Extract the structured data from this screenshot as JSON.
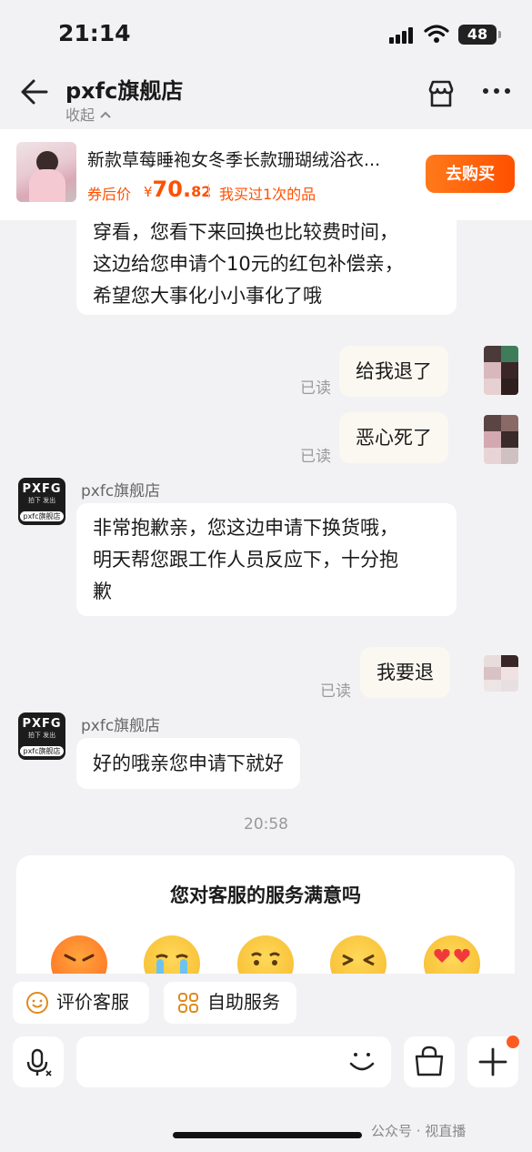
{
  "status_bar": {
    "time": "21:14",
    "battery": "48"
  },
  "header": {
    "shop_name": "pxfc旗舰店",
    "collapse_label": "收起"
  },
  "product": {
    "name": "新款草莓睡袍女冬季长款珊瑚绒浴衣...",
    "price_label": "券后价",
    "currency": "¥",
    "price_integer": "70.",
    "price_decimal": "82",
    "bought_note": "我买过1次的品",
    "buy_button": "去购买"
  },
  "messages": [
    {
      "from": "shop",
      "lines": [
        "穿看，您看下来回换也比较费时间，",
        "这边给您申请个10元的红包补偿亲，",
        "希望您大事化小小事化了哦"
      ]
    },
    {
      "from": "user",
      "text": "给我退了",
      "status": "已读"
    },
    {
      "from": "user",
      "text": "恶心死了",
      "status": "已读"
    },
    {
      "from": "shop",
      "sender": "pxfc旗舰店",
      "lines": [
        "非常抱歉亲，您这边申请下换货哦，",
        "明天帮您跟工作人员反应下，十分抱",
        "歉"
      ]
    },
    {
      "from": "user",
      "text": "我要退",
      "status": "已读"
    },
    {
      "from": "shop",
      "sender": "pxfc旗舰店",
      "lines": [
        "好的哦亲您申请下就好"
      ]
    }
  ],
  "shop_avatar": {
    "line1": "PXFG",
    "line2": "拍下 发出",
    "line3": "pxfc旗舰店"
  },
  "timestamp": "20:58",
  "survey": {
    "question": "您对客服的服务满意吗"
  },
  "actions": {
    "rate_service": "评价客服",
    "self_service": "自助服务"
  },
  "input": {
    "placeholder": ""
  },
  "watermark": "公众号 · 视直播",
  "colors": {
    "accent": "#ff5000",
    "background": "#f2f2f4"
  }
}
